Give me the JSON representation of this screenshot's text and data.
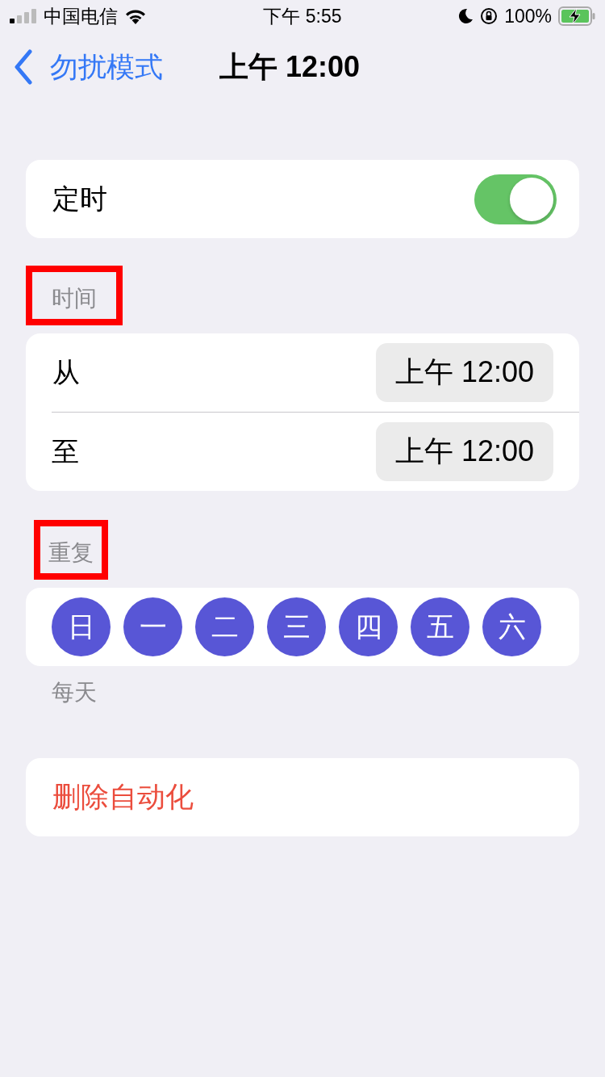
{
  "status_bar": {
    "carrier": "中国电信",
    "time": "下午 5:55",
    "battery": "100%"
  },
  "nav": {
    "back": "勿扰模式",
    "title": "上午 12:00"
  },
  "scheduled": {
    "label": "定时",
    "on": true
  },
  "time_section": {
    "header": "时间",
    "highlighted": true,
    "rows": [
      {
        "label": "从",
        "value": "上午 12:00"
      },
      {
        "label": "至",
        "value": "上午 12:00"
      }
    ]
  },
  "repeat_section": {
    "header": "重复",
    "highlighted": true,
    "days": [
      {
        "label": "日",
        "selected": true
      },
      {
        "label": "一",
        "selected": true
      },
      {
        "label": "二",
        "selected": true
      },
      {
        "label": "三",
        "selected": true
      },
      {
        "label": "四",
        "selected": true
      },
      {
        "label": "五",
        "selected": true
      },
      {
        "label": "六",
        "selected": true
      }
    ],
    "footer": "每天"
  },
  "delete_button": "删除自动化"
}
